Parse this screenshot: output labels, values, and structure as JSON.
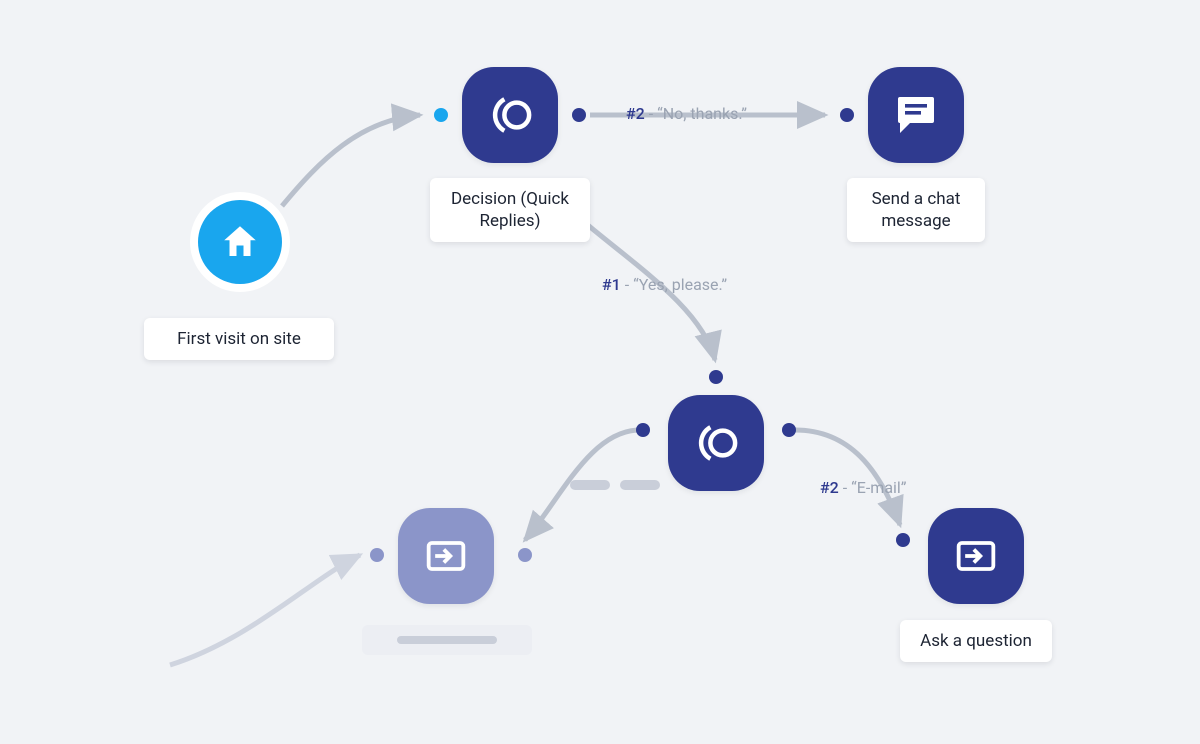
{
  "colors": {
    "bg": "#f1f3f6",
    "navy": "#2f3a8f",
    "navy_faded": "#8b95c9",
    "sky": "#19a6ee",
    "edge": "#b9c0cc",
    "edge_label_muted": "#9aa3b2"
  },
  "nodes": {
    "first_visit": {
      "label": "First visit on site",
      "icon": "home-icon"
    },
    "decision1": {
      "label": "Decision (Quick Replies)",
      "icon": "decision-icon"
    },
    "send_chat": {
      "label": "Send a chat message",
      "icon": "chat-icon"
    },
    "decision2": {
      "label": "",
      "icon": "decision-icon"
    },
    "ask_question": {
      "label": "Ask a question",
      "icon": "input-icon"
    },
    "input_faded": {
      "label": "",
      "icon": "input-icon"
    }
  },
  "edges": {
    "e_first_to_d1": {
      "num": "",
      "text": ""
    },
    "e_d1_to_chat": {
      "num": "#2",
      "text": " - “No, thanks.”"
    },
    "e_d1_to_d2": {
      "num": "#1",
      "text": " - “Yes, please.”"
    },
    "e_d2_to_ask": {
      "num": "#2",
      "text": " - “E-mail”"
    },
    "e_d2_to_faded": {
      "num": "",
      "text": ""
    },
    "e_faded_in": {
      "num": "",
      "text": ""
    }
  }
}
